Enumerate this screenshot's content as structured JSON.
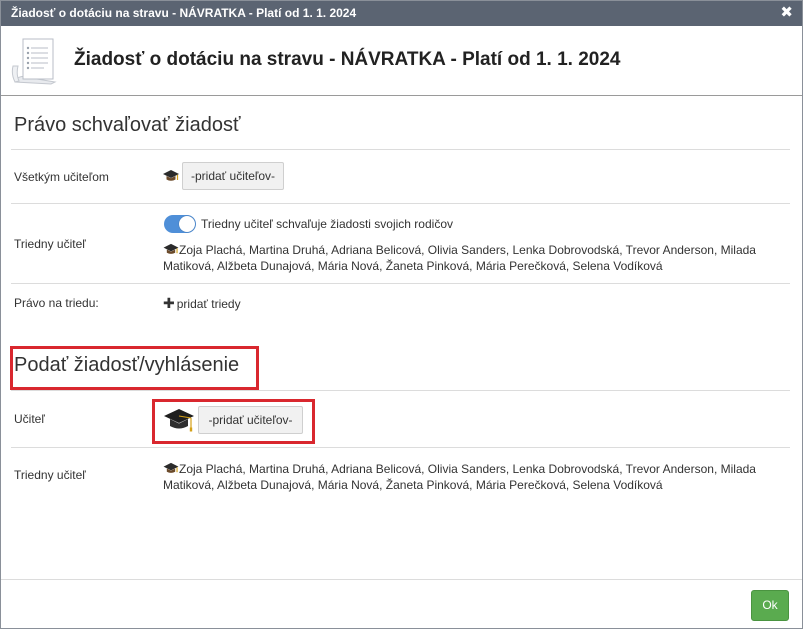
{
  "window": {
    "title": "Žiadosť o dotáciu na stravu - NÁVRATKA - Platí od 1. 1. 2024",
    "close_symbol": "✖"
  },
  "header": {
    "title": "Žiadosť o dotáciu na stravu - NÁVRATKA - Platí od 1. 1. 2024",
    "icon": "document-icon"
  },
  "approve_section": {
    "title": "Právo schvaľovať žiadosť",
    "all_teachers_label": "Všetkým učiteľom",
    "add_teachers_button": "-pridať učiteľov-",
    "class_teacher_label": "Triedny učiteľ",
    "toggle_label": "Triedny učiteľ schvaľuje žiadosti svojich rodičov",
    "toggle_on": true,
    "class_teacher_names": "Zoja Plachá, Martina Druhá, Adriana Belicová, Olivia Sanders, Lenka Dobrovodská, Trevor Anderson, Milada Matiková, Alžbeta Dunajová, Mária Nová, Žaneta Pinková, Mária Perečková, Selena Vodíková",
    "class_right_label": "Právo na triedu:",
    "add_class_link": "pridať triedy"
  },
  "submit_section": {
    "title": "Podať žiadosť/vyhlásenie",
    "teacher_label": "Učiteľ",
    "add_teachers_button": "-pridať učiteľov-",
    "class_teacher_label": "Triedny učiteľ",
    "class_teacher_names": "Zoja Plachá, Martina Druhá, Adriana Belicová, Olivia Sanders, Lenka Dobrovodská, Trevor Anderson, Milada Matiková, Alžbeta Dunajová, Mária Nová, Žaneta Pinková, Mária Perečková, Selena Vodíková"
  },
  "footer": {
    "ok_label": "Ok"
  },
  "colors": {
    "titlebar": "#5b6472",
    "toggle_on": "#4f8fd8",
    "highlight": "#d9272e",
    "ok_button": "#5aab4f"
  },
  "icons": {
    "teacher": "graduation-cap-icon",
    "add": "plus-icon",
    "close": "close-icon"
  }
}
